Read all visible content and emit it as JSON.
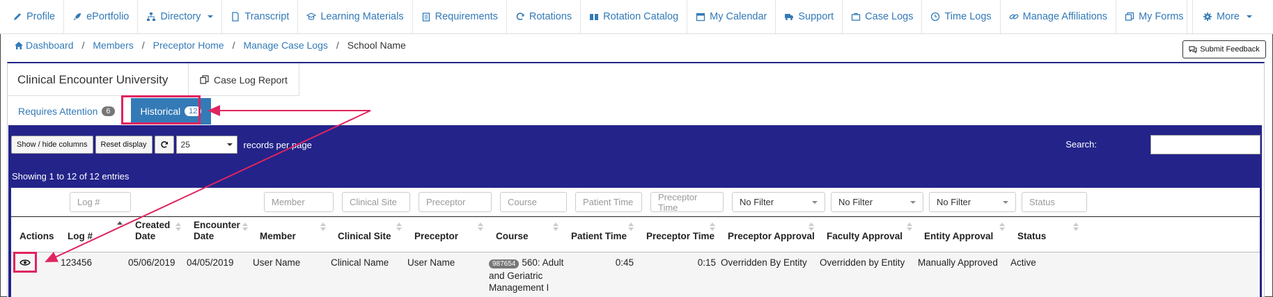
{
  "nav": {
    "items": [
      {
        "label": "Profile",
        "icon": "pencil-icon"
      },
      {
        "label": "ePortfolio",
        "icon": "rocket-icon"
      },
      {
        "label": "Directory",
        "icon": "sitemap-icon",
        "dropdown": true
      },
      {
        "label": "Transcript",
        "icon": "document-icon"
      },
      {
        "label": "Learning Materials",
        "icon": "graduation-cap-icon"
      },
      {
        "label": "Requirements",
        "icon": "clipboard-icon"
      },
      {
        "label": "Rotations",
        "icon": "refresh-icon"
      },
      {
        "label": "Rotation Catalog",
        "icon": "book-open-icon"
      },
      {
        "label": "My Calendar",
        "icon": "calendar-icon"
      },
      {
        "label": "Support",
        "icon": "truck-icon"
      },
      {
        "label": "Case Logs",
        "icon": "briefcase-icon"
      },
      {
        "label": "Time Logs",
        "icon": "clock-icon"
      },
      {
        "label": "Manage Affiliations",
        "icon": "link-icon"
      },
      {
        "label": "My Forms",
        "icon": "forms-icon"
      }
    ],
    "more_label": "More"
  },
  "breadcrumb": {
    "items": [
      "Dashboard",
      "Members",
      "Preceptor Home",
      "Manage Case Logs"
    ],
    "current": "School Name"
  },
  "feedback_label": "Submit Feedback",
  "panel": {
    "title": "Clinical Encounter University",
    "report_label": "Case Log Report"
  },
  "tabs": [
    {
      "label": "Requires Attention",
      "count": "6"
    },
    {
      "label": "Historical",
      "count": "12",
      "active": true
    }
  ],
  "toolbar": {
    "show_hide": "Show / hide columns",
    "reset": "Reset display",
    "page_size": "25",
    "records_label": "records per page",
    "search_label": "Search:"
  },
  "showing_text": "Showing 1 to 12 of 12 entries",
  "filters": {
    "log": "Log #",
    "member": "Member",
    "clinical_site": "Clinical Site",
    "preceptor": "Preceptor",
    "course": "Course",
    "patient_time": "Patient Time",
    "preceptor_time": "Preceptor Time",
    "preceptor_approval": "No Filter",
    "faculty_approval": "No Filter",
    "entity_approval": "No Filter",
    "status": "Status"
  },
  "columns": {
    "actions": "Actions",
    "log": "Log #",
    "created_1": "Created",
    "created_2": "Date",
    "encounter_1": "Encounter",
    "encounter_2": "Date",
    "member": "Member",
    "clinical_site": "Clinical Site",
    "preceptor": "Preceptor",
    "course": "Course",
    "patient_time": "Patient Time",
    "preceptor_time": "Preceptor Time",
    "preceptor_approval": "Preceptor Approval",
    "faculty_approval": "Faculty Approval",
    "entity_approval": "Entity Approval",
    "status": "Status"
  },
  "row": {
    "log": "123456",
    "created": "05/06/2019",
    "encounter": "04/05/2019",
    "member": "User Name",
    "clinical_site": "Clinical Name",
    "preceptor": "User Name",
    "course_code": "987654",
    "course_line1": "560: Adult",
    "course_line2": "and Geriatric",
    "course_line3": "Management I",
    "patient_time": "0:45",
    "preceptor_time": "0:15",
    "preceptor_approval": "Overridden By Entity",
    "faculty_approval": "Overridden by Entity",
    "entity_approval": "Manually Approved",
    "status": "Active"
  },
  "colors": {
    "link": "#337ab7",
    "table_bg": "#23238a",
    "highlight": "#e0245e"
  }
}
